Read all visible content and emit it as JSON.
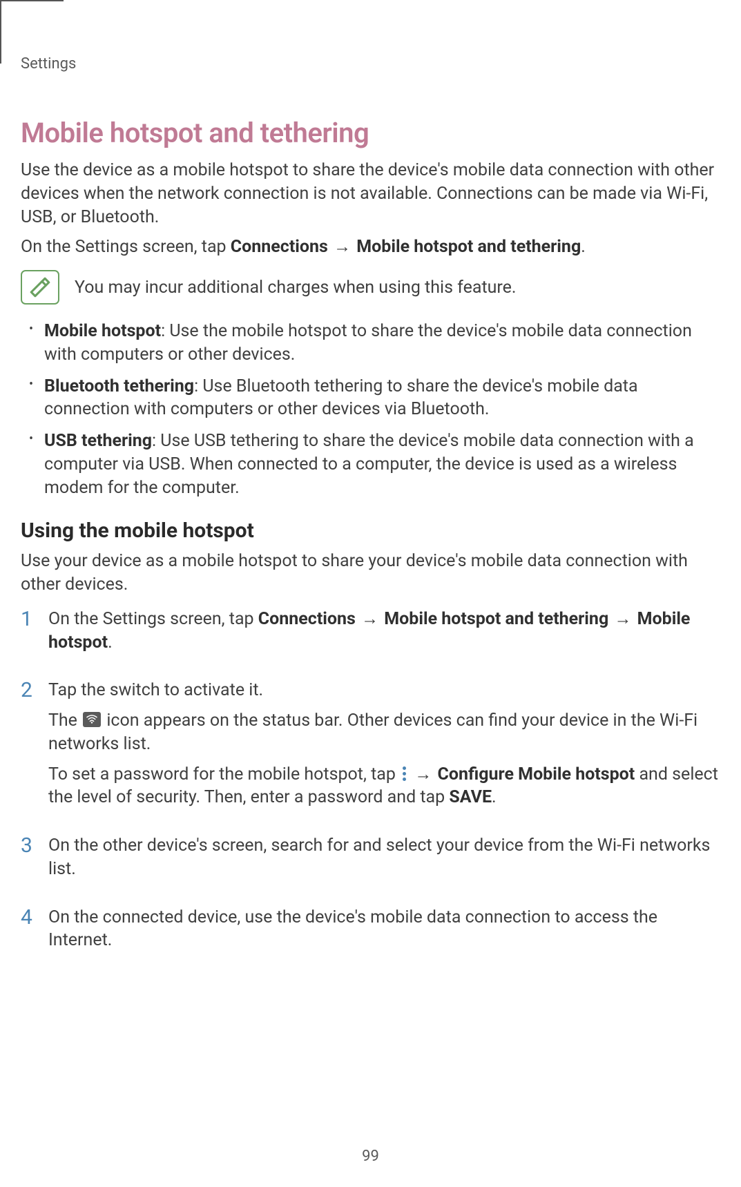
{
  "breadcrumb": "Settings",
  "title": "Mobile hotspot and tethering",
  "intro": "Use the device as a mobile hotspot to share the device's mobile data connection with other devices when the network connection is not available. Connections can be made via Wi-Fi, USB, or Bluetooth.",
  "nav_prefix": "On the Settings screen, tap ",
  "nav_bold1": "Connections",
  "nav_bold2": "Mobile hotspot and tethering",
  "arrow": "→",
  "period": ".",
  "note": "You may incur additional charges when using this feature.",
  "features": [
    {
      "label": "Mobile hotspot",
      "text": ": Use the mobile hotspot to share the device's mobile data connection with computers or other devices."
    },
    {
      "label": "Bluetooth tethering",
      "text": ": Use Bluetooth tethering to share the device's mobile data connection with computers or other devices via Bluetooth."
    },
    {
      "label": "USB tethering",
      "text": ": Use USB tethering to share the device's mobile data connection with a computer via USB. When connected to a computer, the device is used as a wireless modem for the computer."
    }
  ],
  "subheading": "Using the mobile hotspot",
  "subintro": "Use your device as a mobile hotspot to share your device's mobile data connection with other devices.",
  "steps": {
    "s1": {
      "num": "1",
      "prefix": "On the Settings screen, tap ",
      "b1": "Connections",
      "b2": "Mobile hotspot and tethering",
      "b3": "Mobile hotspot"
    },
    "s2": {
      "num": "2",
      "line1": "Tap the switch to activate it.",
      "line2a": "The ",
      "line2b": " icon appears on the status bar. Other devices can find your device in the Wi-Fi networks list.",
      "line3a": "To set a password for the mobile hotspot, tap ",
      "line3_bold": "Configure Mobile hotspot",
      "line3b": " and select the level of security. Then, enter a password and tap ",
      "save": "SAVE"
    },
    "s3": {
      "num": "3",
      "text": "On the other device's screen, search for and select your device from the Wi-Fi networks list."
    },
    "s4": {
      "num": "4",
      "text": "On the connected device, use the device's mobile data connection to access the Internet."
    }
  },
  "page_number": "99"
}
